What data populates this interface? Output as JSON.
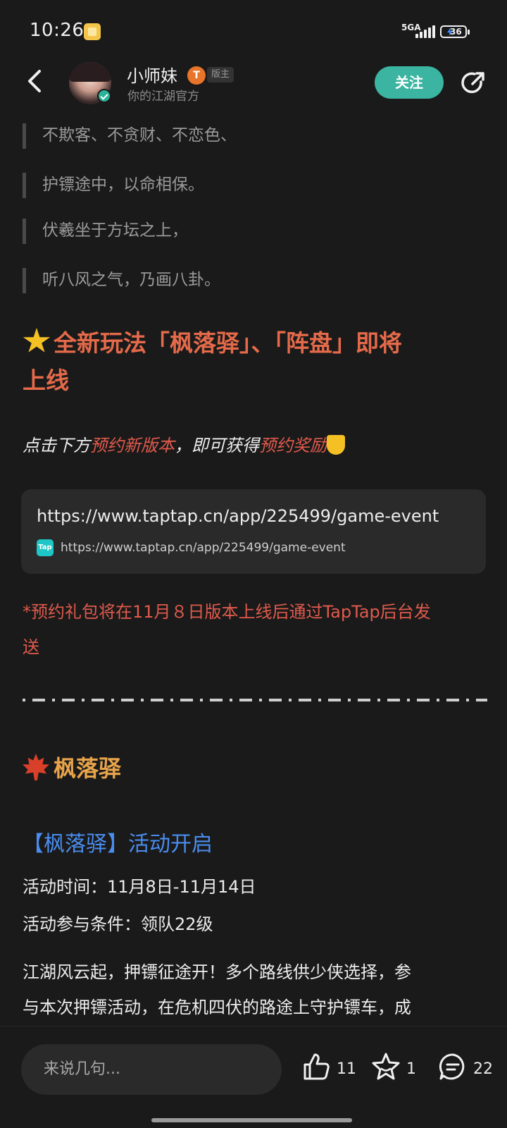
{
  "status_bar": {
    "time": "10:26",
    "network": "5GA",
    "battery": "36"
  },
  "header": {
    "author_name": "小师妹",
    "author_badge_letter": "T",
    "author_role": "版主",
    "author_desc": "你的江湖官方",
    "follow_label": "关注"
  },
  "quotes": [
    [
      "不欺客、不贪财、不恋色、",
      "护镖途中，以命相保。"
    ],
    [
      "伏羲坐于方坛之上，",
      "听八风之气，乃画八卦。"
    ]
  ],
  "headline": {
    "line1": "全新玩法「枫落驿」、「阵盘」即将",
    "line2": "上线"
  },
  "reserve": {
    "prefix": "点击下方",
    "link1": "预约新版本",
    "middle": "，即可获得",
    "link2": "预约奖励"
  },
  "link_card": {
    "title": "https://www.taptap.cn/app/225499/game-event",
    "favicon_text": "Tap",
    "url": "https://www.taptap.cn/app/225499/game-event"
  },
  "notice": {
    "line1": "*预约礼包将在11月８日版本上线后通过TapTap后台发",
    "line2": "送"
  },
  "section2": {
    "title": "枫落驿"
  },
  "event": {
    "title": "【枫落驿】活动开启",
    "time": "活动时间：11月8日-11月14日",
    "condition": "活动参与条件：领队22级",
    "body_line1": "江湖风云起，押镖征途开！多个路线供少侠选择，参",
    "body_line2": "与本次押镖活动，在危机四伏的路途上守护镖车，成"
  },
  "bottom": {
    "comment_placeholder": "来说几句...",
    "likes": "11",
    "favorites": "1",
    "comments": "22"
  },
  "colors": {
    "accent_teal": "#3bb4a1",
    "headline_orange": "#e46a4a",
    "highlight_red": "#e05a4c",
    "section_gold": "#e8a44b",
    "event_blue": "#4a8df0"
  }
}
